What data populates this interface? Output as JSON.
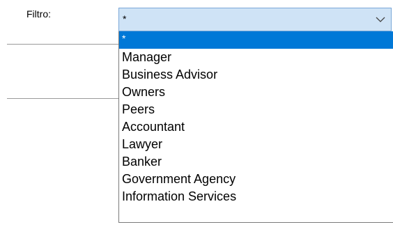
{
  "filter": {
    "label": "Filtro:",
    "selected_value": "*",
    "highlighted_index": 0,
    "options": [
      "*",
      "Manager",
      "Business Advisor",
      "Owners",
      "Peers",
      "Accountant",
      "Lawyer",
      "Banker",
      "Government Agency",
      "Information Services"
    ]
  },
  "colors": {
    "select_background": "#cfe3f6",
    "select_border": "#7aa7d8",
    "highlight": "#0078d7"
  },
  "icons": {
    "dropdown_arrow": "chevron-down-icon"
  }
}
